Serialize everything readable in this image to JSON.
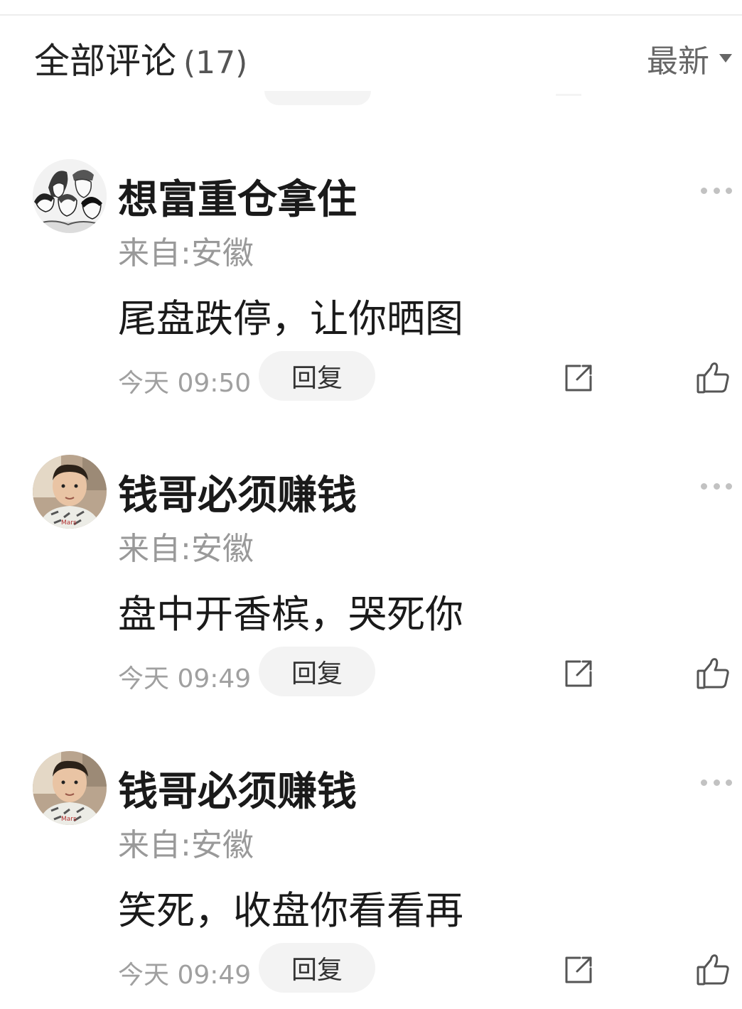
{
  "header": {
    "title": "全部评论",
    "count": "(17)",
    "sort_label": "最新",
    "sort_icon": "triangle-down-icon"
  },
  "comments": [
    {
      "username": "想富重仓拿住",
      "location": "来自:安徽",
      "text": "尾盘跌停，让你晒图",
      "time": "今天 09:50",
      "reply_label": "回复",
      "avatar": "manga-group-avatar"
    },
    {
      "username": "钱哥必须赚钱",
      "location": "来自:安徽",
      "text": "盘中开香槟，哭死你",
      "time": "今天 09:49",
      "reply_label": "回复",
      "avatar": "child-photo-avatar"
    },
    {
      "username": "钱哥必须赚钱",
      "location": "来自:安徽",
      "text": "笑死，收盘你看看再",
      "time": "今天 09:49",
      "reply_label": "回复",
      "avatar": "child-photo-avatar"
    }
  ],
  "icons": {
    "more": "more-icon",
    "share": "share-icon",
    "like": "thumbs-up-icon"
  },
  "colors": {
    "text_primary": "#1a1a1a",
    "text_secondary": "#999999",
    "reply_bg": "#f3f3f3"
  }
}
